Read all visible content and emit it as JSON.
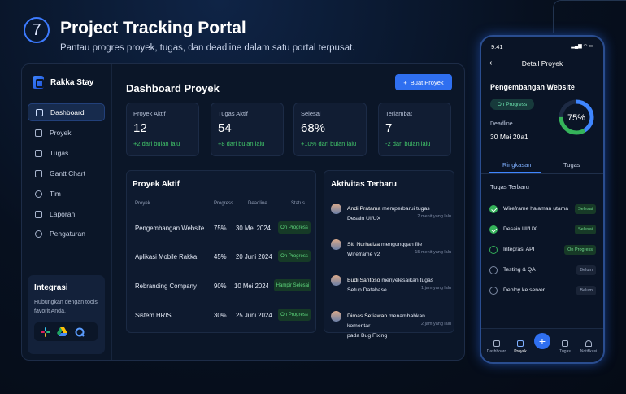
{
  "header": {
    "step": "7",
    "title": "Project Tracking Portal",
    "subtitle": "Pantau progres proyek, tugas, dan deadline dalam satu portal terpusat."
  },
  "sidebar": {
    "brand": "Rakka Stay",
    "items": [
      {
        "label": "Dashboard",
        "icon": "home-icon"
      },
      {
        "label": "Proyek",
        "icon": "folder-icon"
      },
      {
        "label": "Tugas",
        "icon": "checklist-icon"
      },
      {
        "label": "Gantt Chart",
        "icon": "gantt-icon"
      },
      {
        "label": "Tim",
        "icon": "team-icon"
      },
      {
        "label": "Laporan",
        "icon": "report-icon"
      },
      {
        "label": "Pengaturan",
        "icon": "settings-icon"
      }
    ],
    "active": "Dashboard"
  },
  "integration": {
    "title": "Integrasi",
    "text": "Hubungkan dengan tools favorit Anda.",
    "apps": [
      "slack-icon",
      "drive-icon",
      "q-app-icon"
    ]
  },
  "dashboard": {
    "title": "Dashboard Proyek",
    "add_button": "Buat Proyek"
  },
  "stats": [
    {
      "label": "Proyek Aktif",
      "value": "12",
      "delta": "+2 dari bulan lalu"
    },
    {
      "label": "Tugas Aktif",
      "value": "54",
      "delta": "+8 dari bulan lalu"
    },
    {
      "label": "Selesai",
      "value": "68%",
      "delta": "+10% dari bulan lalu"
    },
    {
      "label": "Terlambat",
      "value": "7",
      "delta": "-2 dari bulan lalu"
    }
  ],
  "projects": {
    "title": "Proyek Aktif",
    "headers": [
      "Proyek",
      "Progress",
      "Deadline",
      "Status"
    ],
    "rows": [
      {
        "name": "Pengembangan Website",
        "progress": "75%",
        "deadline": "30 Mei 2024",
        "status": "On Progress"
      },
      {
        "name": "Aplikasi Mobile Rakka",
        "progress": "45%",
        "deadline": "20 Juni 2024",
        "status": "On Progress"
      },
      {
        "name": "Rebranding Company",
        "progress": "90%",
        "deadline": "10 Mei 2024",
        "status": "Hampir Selesai"
      },
      {
        "name": "Sistem HRIS",
        "progress": "30%",
        "deadline": "25 Juni 2024",
        "status": "On Progress"
      }
    ]
  },
  "activity": {
    "title": "Aktivitas Terbaru",
    "items": [
      {
        "name": "Andi Pratama",
        "action": "memperbarui tugas",
        "target": "Desain UI/UX",
        "time": "2 menit yang lalu"
      },
      {
        "name": "Siti Nurhaliza",
        "action": "mengunggah file",
        "target": "Wireframe v2",
        "time": "15 menit yang lalu"
      },
      {
        "name": "Budi Santoso",
        "action": "menyelesaikan tugas",
        "target": "Setup Database",
        "time": "1 jam yang lalu"
      },
      {
        "name": "Dimas Setiawan",
        "action": "menambahkan komentar",
        "target": "pada Bug Fixing",
        "time": "2 jam yang lalu"
      }
    ]
  },
  "phone": {
    "time": "9:41",
    "status_icons": "▂▄▆ ◠ ▭",
    "header": "Detail Proyek",
    "project": "Pengembangan Website",
    "status": "On Progress",
    "deadline_label": "Deadline",
    "deadline": "30 Mei 20a1",
    "progress": 75,
    "progress_label": "75%",
    "tabs": [
      "Ringkasan",
      "Tugas"
    ],
    "tasks_title": "Tugas Terbaru",
    "tasks": [
      {
        "label": "Wireframe halaman utama",
        "state": "done",
        "badge": "Selesai"
      },
      {
        "label": "Desain UI/UX",
        "state": "done",
        "badge": "Selesai"
      },
      {
        "label": "Integrasi API",
        "state": "progress",
        "badge": "On Progress"
      },
      {
        "label": "Testing & QA",
        "state": "todo",
        "badge": "Belum"
      },
      {
        "label": "Deploy ke server",
        "state": "todo",
        "badge": "Belum"
      }
    ],
    "nav": [
      "Dashboard",
      "Proyek",
      "Tugas",
      "Notifikasi"
    ]
  },
  "colors": {
    "accent": "#2f6ff0",
    "success": "#35b35a",
    "background": "#07101f"
  }
}
